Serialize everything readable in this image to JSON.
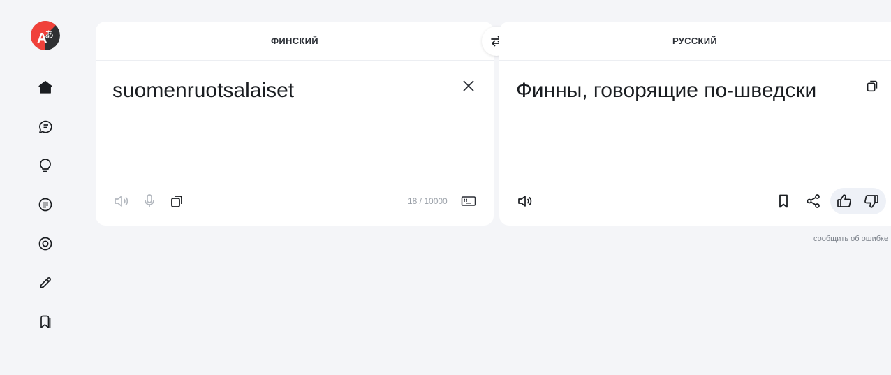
{
  "source": {
    "language": "ФИНСКИЙ",
    "text": "suomenruotsalaiset",
    "counter": "18 / 10000"
  },
  "target": {
    "language": "РУССКИЙ",
    "text": "Финны, говорящие по-шведски"
  },
  "footer": {
    "report_error": "сообщить об ошибке"
  },
  "sidebar": {
    "items": [
      {
        "icon": "home-icon"
      },
      {
        "icon": "chat-icon"
      },
      {
        "icon": "lightbulb-icon"
      },
      {
        "icon": "document-icon"
      },
      {
        "icon": "camera-icon"
      },
      {
        "icon": "pencil-icon"
      },
      {
        "icon": "bookmarks-icon"
      }
    ]
  },
  "colors": {
    "background": "#f4f5f8",
    "panel": "#ffffff",
    "logo_red": "#f0413a",
    "logo_dark": "#2f3033",
    "feedback_bg": "#eef1f7"
  }
}
